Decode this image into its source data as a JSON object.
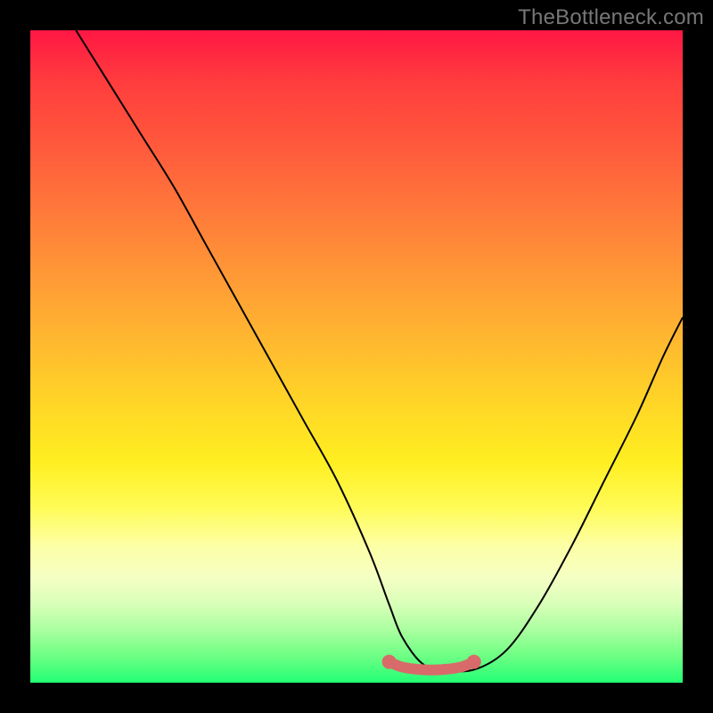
{
  "watermark": "TheBottleneck.com",
  "chart_data": {
    "type": "line",
    "title": "",
    "xlabel": "",
    "ylabel": "",
    "xlim": [
      0,
      100
    ],
    "ylim": [
      0,
      100
    ],
    "grid": false,
    "legend": false,
    "series": [
      {
        "name": "bottleneck-curve",
        "color": "#000000",
        "x": [
          7,
          12,
          17,
          22,
          27,
          32,
          37,
          42,
          47,
          52,
          55,
          57,
          60,
          63,
          68,
          73,
          78,
          83,
          88,
          93,
          97,
          100
        ],
        "y": [
          100,
          92,
          84,
          76,
          67,
          58,
          49,
          40,
          31,
          20,
          12,
          7,
          3,
          2,
          2,
          5,
          12,
          21,
          31,
          41,
          50,
          56
        ]
      },
      {
        "name": "highlight-band",
        "color": "#d86a6a",
        "x": [
          55,
          57,
          60,
          63,
          66,
          68
        ],
        "y": [
          3.2,
          2.4,
          2.0,
          2.0,
          2.4,
          3.2
        ]
      }
    ],
    "gradient_stops": [
      {
        "pos": 0.0,
        "color": "#ff1744"
      },
      {
        "pos": 0.08,
        "color": "#ff3d3d"
      },
      {
        "pos": 0.18,
        "color": "#ff5a3c"
      },
      {
        "pos": 0.28,
        "color": "#ff7a3a"
      },
      {
        "pos": 0.38,
        "color": "#ff9a36"
      },
      {
        "pos": 0.48,
        "color": "#ffb92f"
      },
      {
        "pos": 0.58,
        "color": "#ffd826"
      },
      {
        "pos": 0.66,
        "color": "#ffee20"
      },
      {
        "pos": 0.73,
        "color": "#fffb55"
      },
      {
        "pos": 0.79,
        "color": "#fdffa6"
      },
      {
        "pos": 0.84,
        "color": "#f4ffc4"
      },
      {
        "pos": 0.88,
        "color": "#d8ffb8"
      },
      {
        "pos": 0.92,
        "color": "#a9ff9f"
      },
      {
        "pos": 0.96,
        "color": "#6cff84"
      },
      {
        "pos": 1.0,
        "color": "#22ff74"
      }
    ]
  }
}
